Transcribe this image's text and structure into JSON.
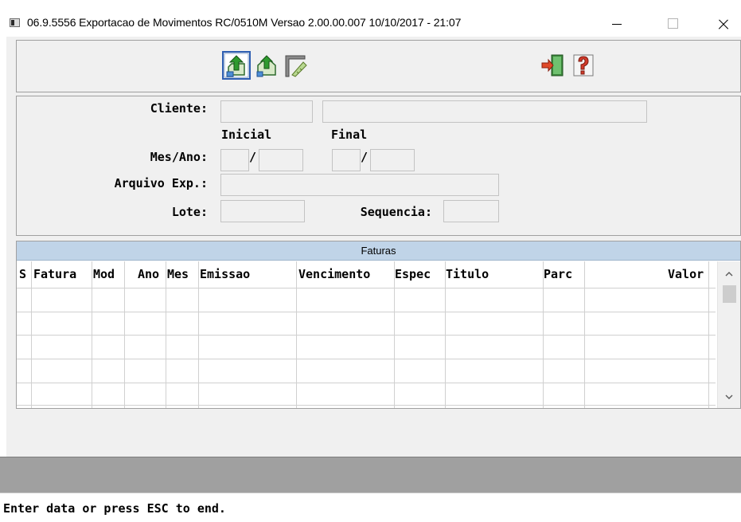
{
  "window": {
    "title": "06.9.5556  Exportacao  de Movimentos RC/0510M Versao 2.00.00.007 10/10/2017 - 21:07"
  },
  "toolbar": {
    "buttons": [
      {
        "icon": "export-upload-icon",
        "focused": true
      },
      {
        "icon": "export-home-icon",
        "focused": false
      },
      {
        "icon": "ruler-edit-icon",
        "focused": false
      },
      {
        "icon": "exit-door-icon",
        "focused": false
      },
      {
        "icon": "help-question-icon",
        "focused": false
      }
    ]
  },
  "form": {
    "cliente_label": "Cliente:",
    "inicial_label": "Inicial",
    "final_label": "Final",
    "mesano_label": "Mes/Ano:",
    "slash": "/",
    "arquivo_label": "Arquivo Exp.:",
    "lote_label": "Lote:",
    "sequencia_label": "Sequencia:",
    "cliente_code": "",
    "cliente_name": "",
    "mes_inicial": "",
    "ano_inicial": "",
    "mes_final": "",
    "ano_final": "",
    "arquivo": "",
    "lote": "",
    "sequencia": ""
  },
  "grid": {
    "title": "Faturas",
    "columns": [
      "S",
      "Fatura",
      "Mod",
      "Ano",
      "Mes",
      "Emissao",
      "Vencimento",
      "Espec",
      "Titulo",
      "Parc",
      "Valor"
    ],
    "rows": []
  },
  "status": {
    "message": "Enter data or press ESC to end."
  },
  "colors": {
    "grid_header_bg": "#c0d4e8",
    "panel_bg": "#f0f0f0",
    "status_band": "#a0a0a0",
    "focus_border": "#2f5fb2"
  }
}
